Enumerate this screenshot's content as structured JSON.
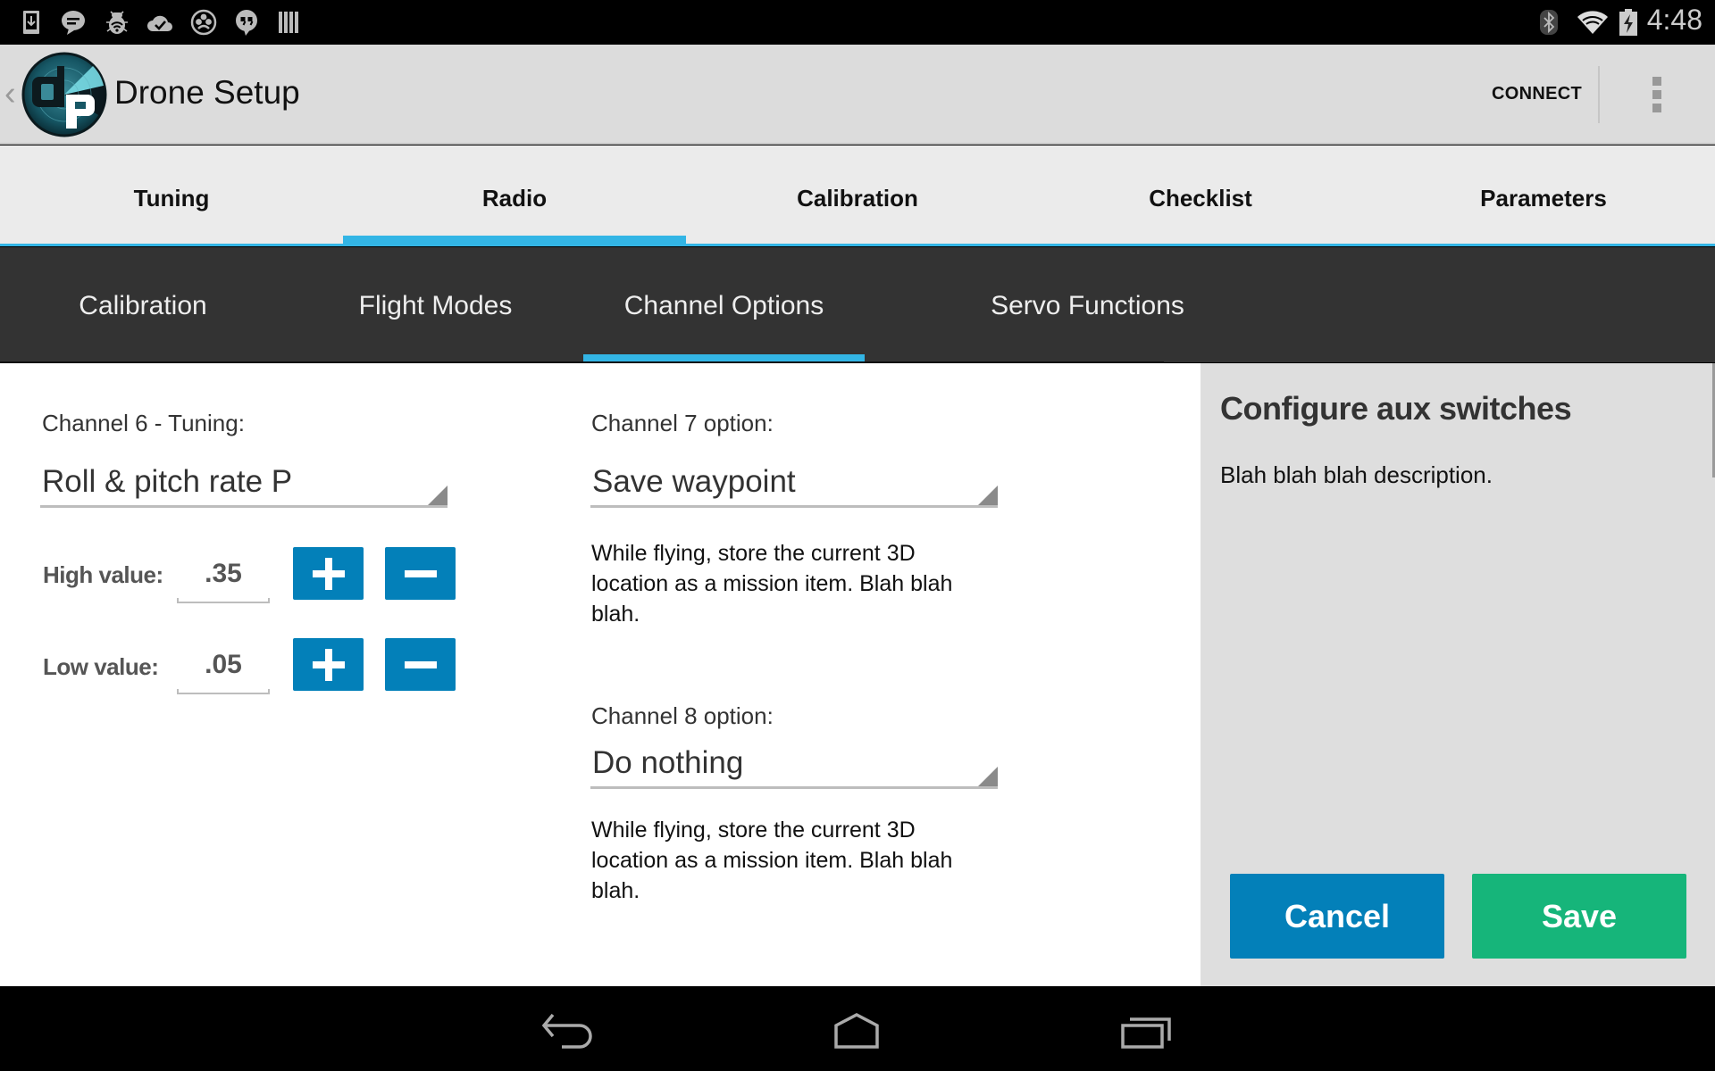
{
  "status_bar": {
    "left_icons": [
      "download-icon",
      "chat-icon",
      "debug-bug-icon",
      "cloud-check-icon",
      "circles-app-icon",
      "hangouts-quote-icon",
      "barcode-icon"
    ],
    "right_icons": [
      "bluetooth-icon",
      "wifi-icon",
      "battery-charging-icon"
    ],
    "time": "4:48"
  },
  "action_bar": {
    "title": "Drone Setup",
    "connect_label": "CONNECT"
  },
  "main_tabs": [
    {
      "label": "Tuning",
      "active": false
    },
    {
      "label": "Radio",
      "active": true
    },
    {
      "label": "Calibration",
      "active": false
    },
    {
      "label": "Checklist",
      "active": false
    },
    {
      "label": "Parameters",
      "active": false
    }
  ],
  "sub_tabs": [
    {
      "label": "Calibration",
      "active": false
    },
    {
      "label": "Flight Modes",
      "active": false
    },
    {
      "label": "Channel Options",
      "active": true
    },
    {
      "label": "Servo Functions",
      "active": false
    }
  ],
  "channel6": {
    "label": "Channel 6 - Tuning:",
    "selected": "Roll & pitch rate P",
    "high_label": "High value:",
    "high_value": ".35",
    "low_label": "Low value:",
    "low_value": ".05"
  },
  "channel7": {
    "label": "Channel 7 option:",
    "selected": "Save waypoint",
    "description": "While flying, store the current 3D location as a mission item. Blah blah blah."
  },
  "channel8": {
    "label": "Channel 8 option:",
    "selected": "Do nothing",
    "description": "While flying, store the current 3D location as a mission item. Blah blah blah."
  },
  "side_panel": {
    "title": "Configure aux switches",
    "description": "Blah blah blah description.",
    "cancel_label": "Cancel",
    "save_label": "Save"
  },
  "colors": {
    "accent": "#33b5e5",
    "button_blue": "#0380b9",
    "button_green": "#16b57a",
    "subtab_bg": "#333333"
  }
}
